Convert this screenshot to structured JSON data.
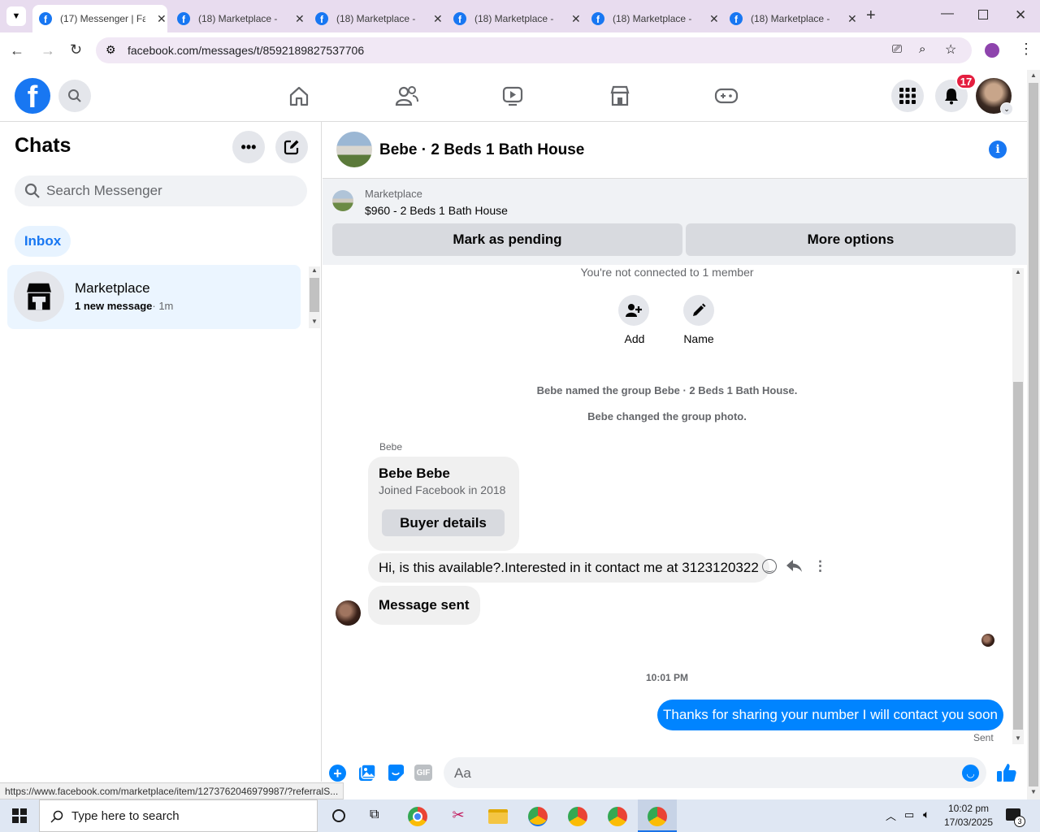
{
  "browser": {
    "tabs": [
      {
        "title": "(17) Messenger | Fa",
        "active": true
      },
      {
        "title": "(18) Marketplace -",
        "active": false
      },
      {
        "title": "(18) Marketplace -",
        "active": false
      },
      {
        "title": "(18) Marketplace -",
        "active": false
      },
      {
        "title": "(18) Marketplace -",
        "active": false
      },
      {
        "title": "(18) Marketplace -",
        "active": false
      }
    ],
    "url": "facebook.com/messages/t/8592189827537706",
    "status_url": "https://www.facebook.com/marketplace/item/1273762046979987/?referralS..."
  },
  "header": {
    "logo": "f",
    "notification_count": "17"
  },
  "sidebar": {
    "title": "Chats",
    "search_placeholder": "Search Messenger",
    "filter_label": "Inbox",
    "chats": [
      {
        "name": "Marketplace",
        "preview": "1 new message",
        "time": "· 1m"
      }
    ]
  },
  "chat": {
    "title": "Bebe · 2 Beds 1 Bath House",
    "listing": {
      "source": "Marketplace",
      "summary": "$960 - 2 Beds 1 Bath House",
      "pending_button": "Mark as pending",
      "options_button": "More options"
    },
    "not_connected": "You're not connected to 1 member",
    "actions": [
      {
        "label": "Add",
        "icon": "add-person-icon"
      },
      {
        "label": "Name",
        "icon": "pencil-icon"
      }
    ],
    "system_messages": [
      "Bebe named the group Bebe · 2 Beds 1 Bath House.",
      "Bebe changed the group photo."
    ],
    "sender_label": "Bebe",
    "profile_card": {
      "name": "Bebe Bebe",
      "joined": "Joined Facebook in 2018",
      "button": "Buyer details"
    },
    "incoming": [
      "Hi, is this available?.Interested in it contact me at 3123120322",
      "Message sent"
    ],
    "timestamp": "10:01 PM",
    "outgoing": "Thanks for sharing your number I will contact you soon",
    "status": "Sent",
    "composer_placeholder": "Aa"
  },
  "taskbar": {
    "search_placeholder": "Type here to search",
    "time": "10:02 pm",
    "date": "17/03/2025",
    "notif_count": "3"
  },
  "colors": {
    "brand": "#1877f2",
    "outgoing_bubble": "#0084ff",
    "badge": "#e41e3f"
  }
}
